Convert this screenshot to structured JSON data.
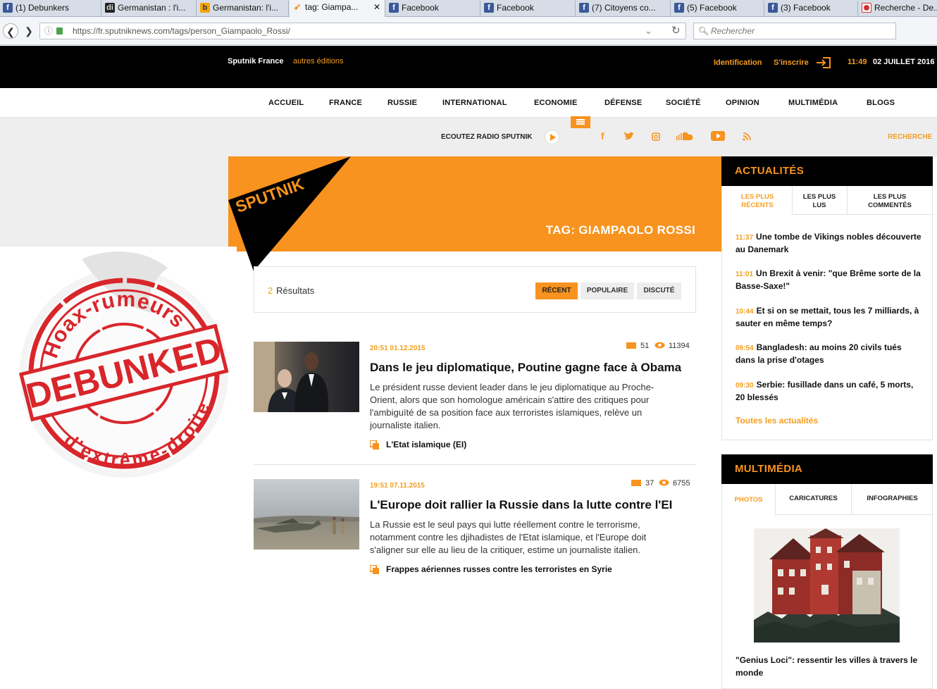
{
  "browser": {
    "tabs": [
      {
        "label": "(1) Debunkers",
        "icon": "facebook-icon"
      },
      {
        "label": "Germanistan : l'i...",
        "icon": "di-icon"
      },
      {
        "label": "Germanistan: l'i...",
        "icon": "blogger-icon"
      },
      {
        "label": "tag: Giampa...",
        "icon": "sputnik-icon",
        "active": true
      },
      {
        "label": "Facebook",
        "icon": "facebook-icon"
      },
      {
        "label": "Facebook",
        "icon": "facebook-icon"
      },
      {
        "label": "(7) Citoyens co...",
        "icon": "facebook-icon"
      },
      {
        "label": "(5) Facebook",
        "icon": "facebook-icon"
      },
      {
        "label": "(3) Facebook",
        "icon": "facebook-icon"
      },
      {
        "label": "Recherche - De...",
        "icon": "debian-icon"
      }
    ],
    "url": "https://fr.sputniknews.com/tags/person_Giampaolo_Rossi/",
    "url_host": "fr.sputniknews.com",
    "search_placeholder": "Rechercher"
  },
  "site": {
    "edition": "Sputnik France",
    "other_editions": "autres éditions",
    "login": "Identification",
    "register": "S'inscrire",
    "time": "11:49",
    "date": "02 JUILLET 2016",
    "logo_text": "SPUTNIK",
    "nav": [
      "ACCUEIL",
      "FRANCE",
      "RUSSIE",
      "INTERNATIONAL",
      "ECONOMIE",
      "DÉFENSE",
      "SOCIÉTÉ",
      "OPINION",
      "MULTIMÉDIA",
      "BLOGS"
    ],
    "radio": "ECOUTEZ RADIO SPUTNIK",
    "search_label": "RECHERCHE"
  },
  "tag_title": "TAG: GIAMPAOLO ROSSI",
  "results": {
    "count": "2",
    "label": "Résultats",
    "sort": [
      "RÉCENT",
      "POPULAIRE",
      "DISCUTÉ"
    ]
  },
  "articles": [
    {
      "datetime": "20:51 01.12.2015",
      "comments": "51",
      "views": "11394",
      "title": "Dans le jeu diplomatique, Poutine gagne face à Obama",
      "lead": "Le président russe devient leader dans le jeu diplomatique au Proche-Orient, alors que son homologue américain s'attire des critiques pour l'ambiguïté de sa position face aux terroristes islamiques, relève un journaliste italien.",
      "tag": "L'Etat islamique (EI)"
    },
    {
      "datetime": "19:51 07.11.2015",
      "comments": "37",
      "views": "6755",
      "title": "L'Europe doit rallier la Russie dans la lutte contre l'EI",
      "lead": "La Russie est le seul pays qui lutte réellement contre le terrorisme, notamment contre les djihadistes de l'Etat islamique, et l'Europe doit s'aligner sur elle au lieu de la critiquer, estime un journaliste italien.",
      "tag": "Frappes aériennes russes contre les terroristes en Syrie"
    }
  ],
  "sidebar": {
    "news_title": "ACTUALITÉS",
    "news_tabs": [
      "LES PLUS RÉCENTS",
      "LES PLUS LUS",
      "LES PLUS COMMENTÉS"
    ],
    "news": [
      {
        "time": "11:37",
        "text": "Une tombe de Vikings nobles découverte au Danemark"
      },
      {
        "time": "11:01",
        "text": "Un Brexit à venir: \"que Brême sorte de la Basse-Saxe!\""
      },
      {
        "time": "10:44",
        "text": "Et si on se mettait, tous les 7 milliards, à sauter en même temps?"
      },
      {
        "time": "09:54",
        "text": "Bangladesh: au moins 20 civils tués dans la prise d'otages"
      },
      {
        "time": "09:30",
        "text": "Serbie: fusillade dans un café, 5 morts, 20 blessés"
      }
    ],
    "all_news": "Toutes les actualités",
    "media_title": "MULTIMÉDIA",
    "media_tabs": [
      "PHOTOS",
      "CARICATURES",
      "INFOGRAPHIES"
    ],
    "photo_caption": "\"Genius Loci\": ressentir les villes à travers le monde"
  },
  "stamp": {
    "top_text": "Hoax-rumeurs",
    "main_text": "DEBUNKED",
    "bottom_text": "d'extrême-droite"
  },
  "colors": {
    "accent": "#f7931e",
    "black": "#000000",
    "stamp_red": "#d8262b"
  }
}
